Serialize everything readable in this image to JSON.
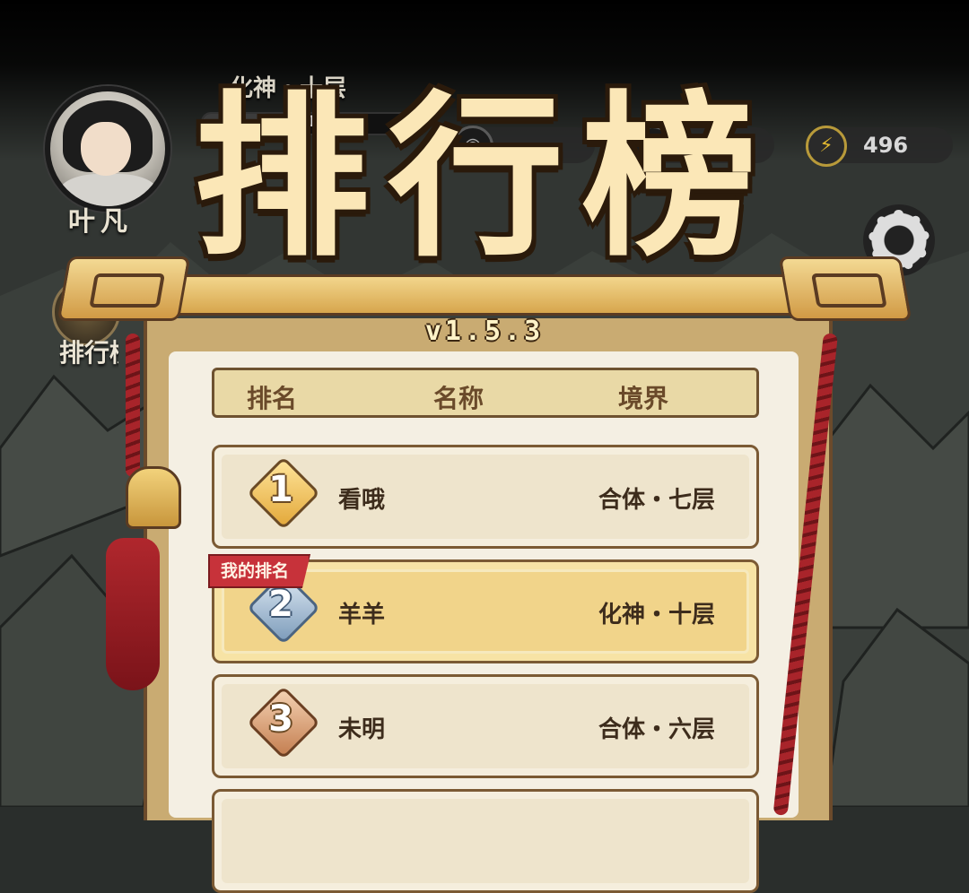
{
  "player": {
    "name": "叶凡",
    "realm": "化神・十层",
    "xp_text": "192/1",
    "xp_fraction": 0.3
  },
  "resources": [
    {
      "icon": "coin-icon",
      "value": ""
    },
    {
      "icon": "gem-icon",
      "value": ""
    },
    {
      "icon": "lightning-icon",
      "value": "496"
    }
  ],
  "side_menu": {
    "leaderboard_label": "排行榜"
  },
  "leaderboard": {
    "title": "排行榜",
    "version": "v1.5.3",
    "columns": {
      "rank": "排名",
      "name": "名称",
      "realm": "境界"
    },
    "my_rank_badge": "我的排名",
    "rows": [
      {
        "rank": "1",
        "name": "看哦",
        "realm": "合体・七层"
      },
      {
        "rank": "2",
        "name": "羊羊",
        "realm": "化神・十层"
      },
      {
        "rank": "3",
        "name": "未明",
        "realm": "合体・六层"
      }
    ]
  },
  "colors": {
    "accent_gold": "#f2d68c",
    "rope_red": "#a8242a",
    "badge_red": "#c7323a"
  }
}
